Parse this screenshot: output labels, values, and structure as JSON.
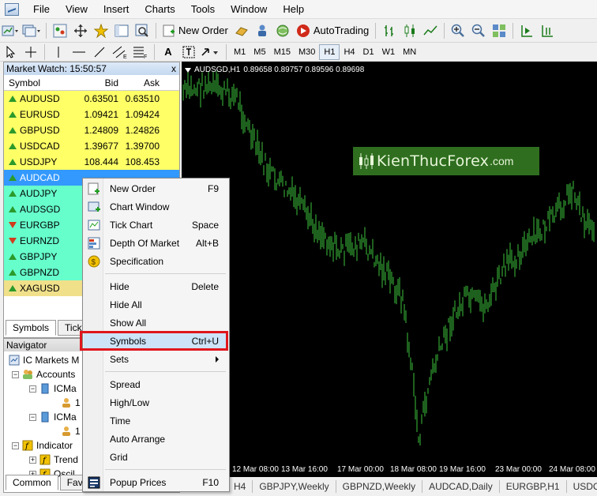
{
  "menubar": {
    "items": [
      "File",
      "View",
      "Insert",
      "Charts",
      "Tools",
      "Window",
      "Help"
    ]
  },
  "toolbar": {
    "new_order_label": "New Order",
    "autotrading_label": "AutoTrading",
    "text_tool": "A",
    "timeframes": [
      "M1",
      "M5",
      "M15",
      "M30",
      "H1",
      "H4",
      "D1",
      "W1",
      "MN"
    ],
    "active_timeframe": "H1"
  },
  "market_watch": {
    "title": "Market Watch: 15:50:57",
    "close": "x",
    "headers": {
      "symbol": "Symbol",
      "bid": "Bid",
      "ask": "Ask"
    },
    "rows": [
      {
        "symbol": "AUDUSD",
        "bid": "0.63501",
        "ask": "0.63510",
        "dir": "up",
        "bg": "#ffff66"
      },
      {
        "symbol": "EURUSD",
        "bid": "1.09421",
        "ask": "1.09424",
        "dir": "up",
        "bg": "#ffff66"
      },
      {
        "symbol": "GBPUSD",
        "bid": "1.24809",
        "ask": "1.24826",
        "dir": "up",
        "bg": "#ffff66"
      },
      {
        "symbol": "USDCAD",
        "bid": "1.39677",
        "ask": "1.39700",
        "dir": "up",
        "bg": "#ffff66"
      },
      {
        "symbol": "USDJPY",
        "bid": "108.444",
        "ask": "108.453",
        "dir": "up",
        "bg": "#ffff66"
      },
      {
        "symbol": "AUDCAD",
        "bid": "",
        "ask": "",
        "dir": "up",
        "bg": "#3399ff",
        "selected": true
      },
      {
        "symbol": "AUDJPY",
        "bid": "",
        "ask": "",
        "dir": "up",
        "bg": "#66ffcc"
      },
      {
        "symbol": "AUDSGD",
        "bid": "",
        "ask": "",
        "dir": "up",
        "bg": "#66ffcc"
      },
      {
        "symbol": "EURGBP",
        "bid": "",
        "ask": "",
        "dir": "down",
        "bg": "#66ffcc"
      },
      {
        "symbol": "EURNZD",
        "bid": "",
        "ask": "",
        "dir": "down",
        "bg": "#66ffcc"
      },
      {
        "symbol": "GBPJPY",
        "bid": "",
        "ask": "",
        "dir": "up",
        "bg": "#66ffcc"
      },
      {
        "symbol": "GBPNZD",
        "bid": "",
        "ask": "",
        "dir": "up",
        "bg": "#66ffcc"
      },
      {
        "symbol": "XAGUSD",
        "bid": "",
        "ask": "",
        "dir": "up",
        "bg": "#f0e08a"
      }
    ],
    "tabs": [
      "Symbols",
      "Tick"
    ]
  },
  "navigator": {
    "title": "Navigator",
    "items": {
      "root": "IC Markets M",
      "accounts": "Accounts",
      "acc1": "ICMa",
      "acc1_child": "1",
      "acc2": "ICMa",
      "acc2_child": "1",
      "indicators": "Indicator",
      "trend": "Trend",
      "osc": "Oscil"
    },
    "tabs": [
      "Common",
      "Fav"
    ]
  },
  "chart": {
    "info_symbol": "AUDSGD,H1",
    "info_values": "0.89658 0.89757 0.89596 0.89698",
    "watermark": "KienThucForex",
    "watermark_suffix": ".com",
    "time_labels": [
      "12 Mar 08:00",
      "13 Mar 16:00",
      "17 Mar 00:00",
      "18 Mar 08:00",
      "19 Mar 16:00",
      "23 Mar 00:00",
      "24 Mar 08:00"
    ],
    "colors": {
      "background": "#000000",
      "bars": "#3cc23c"
    }
  },
  "chart_tabs": [
    "H4",
    "GBPJPY,Weekly",
    "GBPNZD,Weekly",
    "AUDCAD,Daily",
    "EURGBP,H1",
    "USDC"
  ],
  "context_menu": {
    "items": [
      {
        "label": "New Order",
        "shortcut": "F9",
        "icon": "new-order-icon"
      },
      {
        "label": "Chart Window",
        "shortcut": "",
        "icon": "chart-window-icon"
      },
      {
        "label": "Tick Chart",
        "shortcut": "Space",
        "icon": "tick-chart-icon"
      },
      {
        "label": "Depth Of Market",
        "shortcut": "Alt+B",
        "icon": "depth-of-market-icon"
      },
      {
        "label": "Specification",
        "shortcut": "",
        "icon": "specification-icon"
      },
      {
        "label": "Hide",
        "shortcut": "Delete",
        "icon": ""
      },
      {
        "label": "Hide All",
        "shortcut": "",
        "icon": ""
      },
      {
        "label": "Show All",
        "shortcut": "",
        "icon": ""
      },
      {
        "label": "Symbols",
        "shortcut": "Ctrl+U",
        "icon": "",
        "highlighted": true
      },
      {
        "label": "Sets",
        "shortcut": "",
        "icon": "",
        "submenu": true
      },
      {
        "label": "Spread",
        "shortcut": "",
        "icon": ""
      },
      {
        "label": "High/Low",
        "shortcut": "",
        "icon": ""
      },
      {
        "label": "Time",
        "shortcut": "",
        "icon": ""
      },
      {
        "label": "Auto Arrange",
        "shortcut": "",
        "icon": ""
      },
      {
        "label": "Grid",
        "shortcut": "",
        "icon": ""
      },
      {
        "label": "Popup Prices",
        "shortcut": "F10",
        "icon": "popup-prices-icon"
      }
    ]
  }
}
